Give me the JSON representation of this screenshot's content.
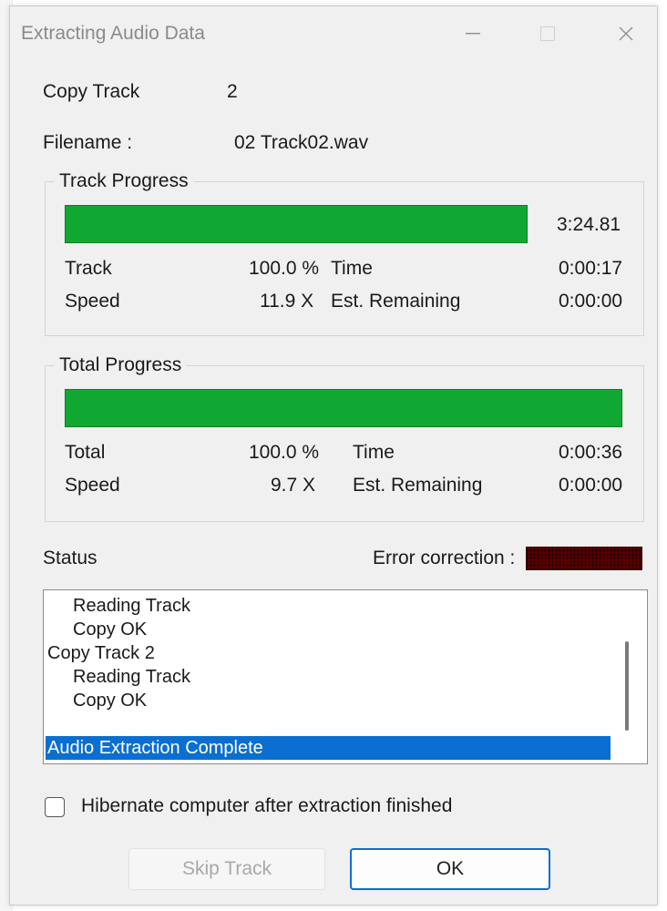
{
  "window": {
    "title": "Extracting Audio Data"
  },
  "info": {
    "copy_track_label": "Copy Track",
    "copy_track_value": "2",
    "filename_label": "Filename :",
    "filename_value": "02 Track02.wav"
  },
  "track_progress": {
    "title": "Track Progress",
    "fill_fraction": 1.0,
    "length": "3:24.81",
    "track_label": "Track",
    "track_value": "100.0 %",
    "time_label": "Time",
    "time_value": "0:00:17",
    "speed_label": "Speed",
    "speed_value": "11.9 X",
    "remaining_label": "Est. Remaining",
    "remaining_value": "0:00:00"
  },
  "total_progress": {
    "title": "Total Progress",
    "fill_fraction": 1.0,
    "total_label": "Total",
    "total_value": "100.0 %",
    "time_label": "Time",
    "time_value": "0:00:36",
    "speed_label": "Speed",
    "speed_value": "9.7 X",
    "remaining_label": "Est. Remaining",
    "remaining_value": "0:00:00"
  },
  "status": {
    "label": "Status",
    "error_correction_label": "Error correction :",
    "log": [
      "Reading Track",
      "Copy OK",
      "Copy Track  2",
      "Reading Track",
      "Copy OK"
    ],
    "selected_line": "Audio Extraction Complete"
  },
  "options": {
    "hibernate_label": "Hibernate computer after extraction finished",
    "hibernate_checked": false
  },
  "buttons": {
    "skip": "Skip Track",
    "ok": "OK"
  },
  "colors": {
    "progress": "#10a832",
    "selection": "#0a6fd0",
    "error_meter": "#5a0000"
  }
}
